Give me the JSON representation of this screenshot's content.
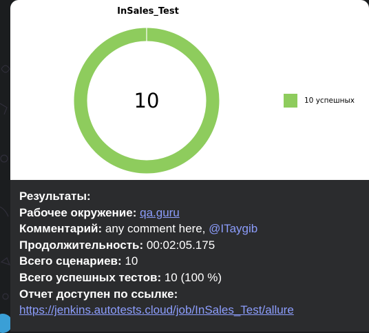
{
  "chart": {
    "title": "InSales_Test",
    "center_value": "10",
    "legend_label": "10 успешных",
    "color": "#8ecc5d"
  },
  "chart_data": {
    "type": "pie",
    "title": "InSales_Test",
    "categories": [
      "10 успешных"
    ],
    "values": [
      10
    ],
    "legend": "right"
  },
  "message": {
    "results_label": "Результаты:",
    "env_label": "Рабочее окружение:",
    "env_link": "qa.guru",
    "comment_label": "Комментарий:",
    "comment_text": "any comment here,",
    "comment_mention": "@ITaygib",
    "duration_label": "Продолжительность:",
    "duration_value": "00:02:05.175",
    "scenarios_label": "Всего сценариев:",
    "scenarios_value": "10",
    "passed_label": "Всего успешных тестов:",
    "passed_value": "10 (100 %)",
    "report_label": "Отчет доступен по ссылке:",
    "report_link": "https://jenkins.autotests.cloud/job/InSales_Test/allure"
  },
  "colors": {
    "bubble_bg": "#2b2c2e",
    "link": "#8c9dfc",
    "success": "#8ecc5d"
  }
}
